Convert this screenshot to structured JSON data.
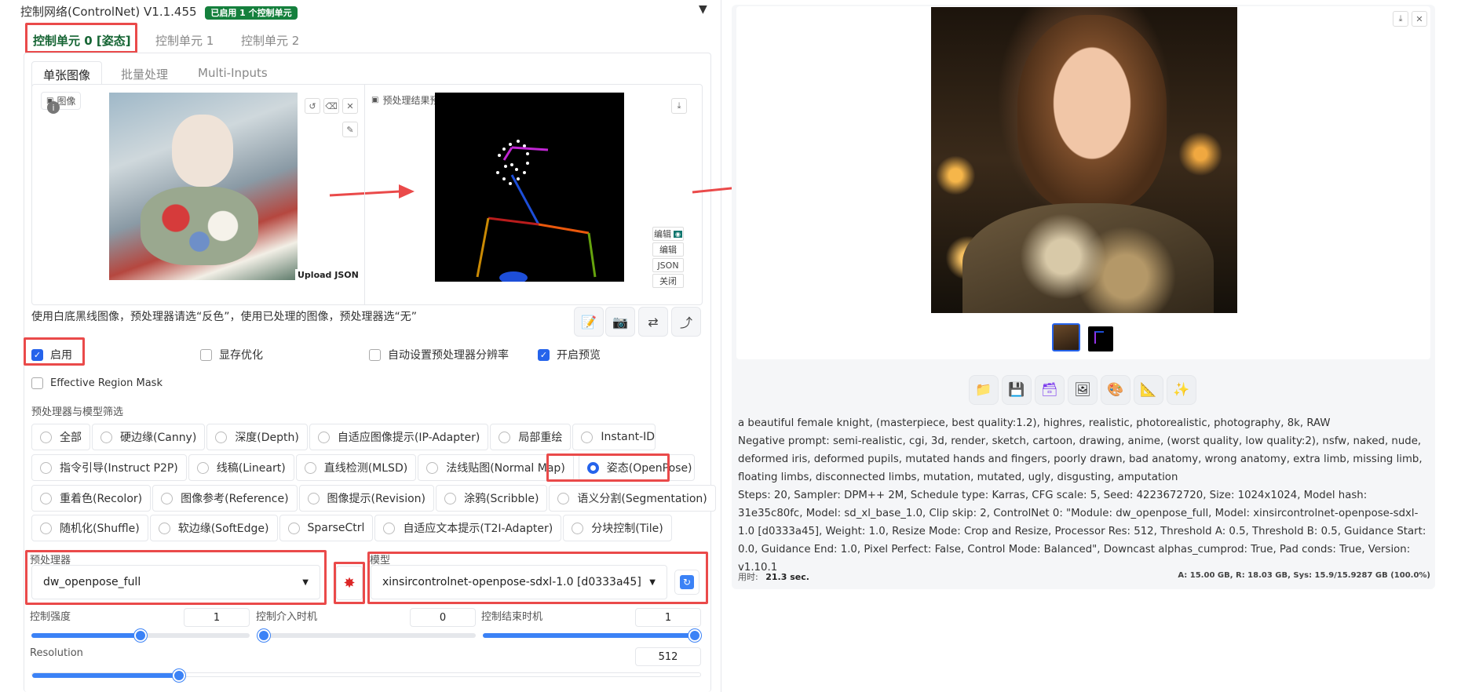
{
  "header": {
    "title": "控制网络(ControlNet) V1.1.455",
    "badge": "已启用 1 个控制单元",
    "collapse_icon": "triangle-down-icon"
  },
  "unit_tabs": [
    {
      "label": "控制单元 0 [姿态]",
      "active": true
    },
    {
      "label": "控制单元 1"
    },
    {
      "label": "控制单元 2"
    }
  ],
  "sub_tabs": [
    {
      "label": "单张图像",
      "active": true
    },
    {
      "label": "批量处理"
    },
    {
      "label": "Multi-Inputs"
    }
  ],
  "image_panel": {
    "label": "图像",
    "upload_json": "Upload JSON"
  },
  "preview_panel": {
    "label": "预处理结果预览",
    "edit_btn1": "编辑",
    "edit_btn2": "编辑",
    "json_btn": "JSON",
    "close_btn": "关闭"
  },
  "hint_text": "使用白底黑线图像，预处理器请选“反色”，使用已处理的图像，预处理器选“无”",
  "checkboxes": {
    "enable": "启用",
    "low_vram": "显存优化",
    "pixel_perfect": "自动设置预处理器分辨率",
    "allow_preview": "开启预览",
    "region_mask": "Effective Region Mask"
  },
  "filter_label": "预处理器与模型筛选",
  "control_types": [
    [
      "全部",
      "硬边缘(Canny)",
      "深度(Depth)",
      "自适应图像提示(IP-Adapter)",
      "局部重绘",
      "Instant-ID"
    ],
    [
      "指令引导(Instruct P2P)",
      "线稿(Lineart)",
      "直线检测(MLSD)",
      "法线贴图(Normal Map)",
      "姿态(OpenPose)"
    ],
    [
      "重着色(Recolor)",
      "图像参考(Reference)",
      "图像提示(Revision)",
      "涂鸦(Scribble)",
      "语义分割(Segmentation)"
    ],
    [
      "随机化(Shuffle)",
      "软边缘(SoftEdge)",
      "SparseCtrl",
      "自适应文本提示(T2I-Adapter)",
      "分块控制(Tile)"
    ]
  ],
  "selected_control_type": "姿态(OpenPose)",
  "preprocessor": {
    "label": "预处理器",
    "value": "dw_openpose_full"
  },
  "model": {
    "label": "模型",
    "value": "xinsircontrolnet-openpose-sdxl-1.0 [d0333a45]"
  },
  "sliders": {
    "weight": {
      "label": "控制强度",
      "value": "1",
      "fraction": 0.5
    },
    "start": {
      "label": "控制介入时机",
      "value": "0",
      "fraction": 0.0
    },
    "end": {
      "label": "控制结束时机",
      "value": "1",
      "fraction": 1.0
    },
    "resolution": {
      "label": "Resolution",
      "value": "512",
      "fraction": 0.22
    }
  },
  "output": {
    "prompt": "a beautiful female knight, (masterpiece, best quality:1.2), highres, realistic, photorealistic, photography, 8k, RAW",
    "negative": "Negative prompt: semi-realistic, cgi, 3d, render, sketch, cartoon, drawing, anime, (worst quality, low quality:2), nsfw, naked, nude, deformed iris, deformed pupils, mutated hands and fingers, poorly drawn, bad anatomy, wrong anatomy, extra limb, missing limb, floating limbs, disconnected limbs, mutation, mutated, ugly, disgusting, amputation",
    "params": "Steps: 20, Sampler: DPM++ 2M, Schedule type: Karras, CFG scale: 5, Seed: 4223672720, Size: 1024x1024, Model hash: 31e35c80fc, Model: sd_xl_base_1.0, Clip skip: 2, ControlNet 0: \"Module: dw_openpose_full, Model: xinsircontrolnet-openpose-sdxl-1.0 [d0333a45], Weight: 1.0, Resize Mode: Crop and Resize, Processor Res: 512, Threshold A: 0.5, Threshold B: 0.5, Guidance Start: 0.0, Guidance End: 1.0, Pixel Perfect: False, Control Mode: Balanced\", Downcast alphas_cumprod: True, Pad conds: True, Version: v1.10.1",
    "time_label": "用时:",
    "time_value": "21.3 sec.",
    "vram": "A: 15.00 GB, R: 18.03 GB, Sys: 15.9/15.9287 GB (100.0%)"
  },
  "colors": {
    "accent": "#2563eb",
    "brand_green": "#15803d",
    "annotation_red": "#ea4a4a"
  }
}
